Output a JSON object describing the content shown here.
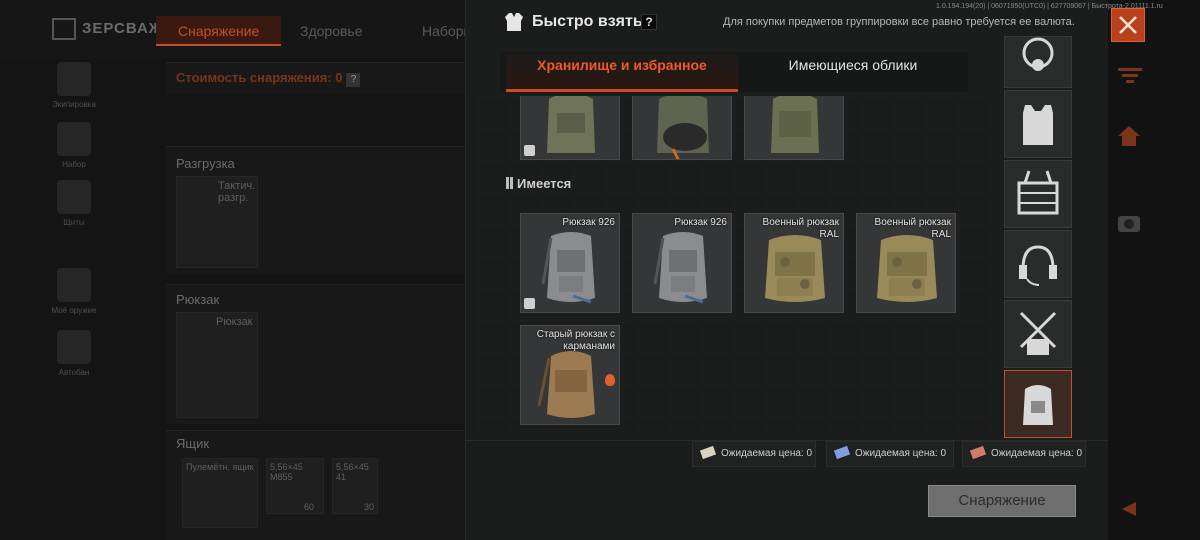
{
  "background": {
    "logo": "ЗЕРСВАЖ",
    "tabs": [
      "Снаряжение",
      "Здоровье",
      "Наборы"
    ],
    "sidebar": [
      "Экипировка",
      "Набор",
      "Щиты",
      "Моё оружие",
      "Автобан"
    ],
    "cost_label": "Стоимость снаряжения: 0",
    "help": "?",
    "vest_title": "Разгрузка",
    "vest_item": "Тактич. разгр.",
    "backpack_title": "Рюкзак",
    "backpack_item": "Рюкзак",
    "box_title": "Ящик",
    "box_items": [
      {
        "label": "Пулемётн. ящик",
        "count": ""
      },
      {
        "label": "5,56×45 M855",
        "count": "60"
      },
      {
        "label": "5,56×45 41",
        "count": "30"
      }
    ]
  },
  "header": {
    "title": "Быстро взять",
    "help": "?",
    "note": "Для покупки предметов группировки все равно требуется ее валюта.",
    "version": "1.0.194.194(20) | 06071950(UTC0) | 627709067 | Быстрота-2.01111.1.ru",
    "close_icon": "close-x-icon"
  },
  "tabs": [
    {
      "label": "Хранилище и избранное",
      "active": true
    },
    {
      "label": "Имеющиеся облики",
      "active": false
    }
  ],
  "section": {
    "title": "Имеется"
  },
  "top_cards": [
    {
      "label": "",
      "color": "#6f7459",
      "badge": true
    },
    {
      "label": "",
      "color": "#5f6450",
      "badge": false
    },
    {
      "label": "",
      "color": "#6b7052",
      "badge": false
    }
  ],
  "cards": [
    {
      "label": "Рюкзак 926",
      "color": "#8a8c8e",
      "badge": true,
      "fire": false
    },
    {
      "label": "Рюкзак 926",
      "color": "#8a8c8e",
      "badge": false,
      "fire": false
    },
    {
      "label": "Военный рюкзак RAL",
      "color": "#9a8a5a",
      "badge": false,
      "fire": false
    },
    {
      "label": "Военный рюкзак RAL",
      "color": "#9a8a5a",
      "badge": false,
      "fire": false
    },
    {
      "label": "Старый рюкзак с карманами",
      "color": "#9c7a52",
      "badge": false,
      "fire": true
    }
  ],
  "slots": [
    {
      "icon": "gas-mask-icon"
    },
    {
      "icon": "body-armor-icon"
    },
    {
      "icon": "chest-rig-icon"
    },
    {
      "icon": "headset-icon"
    },
    {
      "icon": "harness-icon"
    },
    {
      "icon": "backpack-icon",
      "active": true
    }
  ],
  "prices": [
    {
      "label": "Ожидаемая цена:",
      "value": "0",
      "color": "#d8d2c0"
    },
    {
      "label": "Ожидаемая цена:",
      "value": "0",
      "color": "#7f9fe0"
    },
    {
      "label": "Ожидаемая цена:",
      "value": "0",
      "color": "#d27a6a"
    }
  ],
  "equip_button": "Снаряжение",
  "colors": {
    "accent": "#d04a1d",
    "panel": "#1b1c1c"
  }
}
